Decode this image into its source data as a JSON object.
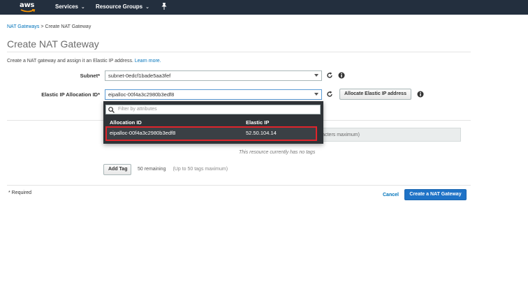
{
  "nav": {
    "logo": "aws",
    "services": "Services",
    "resource_groups": "Resource Groups"
  },
  "breadcrumb": {
    "parent": "NAT Gateways",
    "separator": ">",
    "current": "Create NAT Gateway"
  },
  "page": {
    "title": "Create NAT Gateway",
    "intro": "Create a NAT gateway and assign it an Elastic IP address.",
    "learn_more": "Learn more."
  },
  "form": {
    "subnet_label": "Subnet*",
    "subnet_value": "subnet-0edcf1bade5aa3fef",
    "eip_label": "Elastic IP Allocation ID*",
    "eip_value": "eipalloc-00f4a3c2980b3edf8",
    "allocate_button": "Allocate Elastic IP address"
  },
  "dropdown": {
    "filter_placeholder": "Filter by attributes",
    "columns": [
      "Allocation ID",
      "Elastic IP"
    ],
    "rows": [
      {
        "allocation_id": "eipalloc-00f4a3c2980b3edf8",
        "elastic_ip": "52.50.104.14"
      }
    ]
  },
  "tags": {
    "header_fragment": "aracters maximum)",
    "empty_message": "This resource currently has no tags",
    "add_button": "Add Tag",
    "remaining": "50 remaining",
    "limit_note": "(Up to 50 tags maximum)"
  },
  "footer": {
    "required": "* Required",
    "cancel": "Cancel",
    "create": "Create a NAT Gateway"
  },
  "colors": {
    "nav_bg": "#232f3e",
    "link": "#0073bb",
    "primary": "#1f73c7",
    "dropdown_bg": "#2f3337",
    "highlight": "#e0242b",
    "smile": "#ff9900"
  }
}
